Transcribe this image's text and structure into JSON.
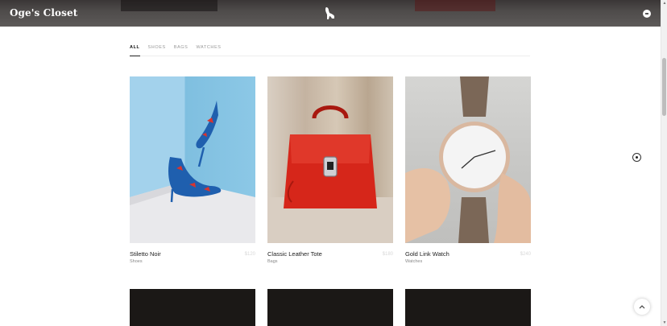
{
  "header": {
    "brand": "Oge's Closet",
    "logo_icon": "high-heel-logo-icon",
    "menu_icon": "menu-icon"
  },
  "filters": {
    "tabs": [
      {
        "label": "ALL",
        "active": true
      },
      {
        "label": "SHOES",
        "active": false
      },
      {
        "label": "BAGS",
        "active": false
      },
      {
        "label": "WATCHES",
        "active": false
      }
    ]
  },
  "products": [
    {
      "name": "Stiletto Noir",
      "category": "Shoes",
      "price": "$120",
      "image_icon": "floral-stiletto-image"
    },
    {
      "name": "Classic Leather Tote",
      "category": "Bags",
      "price": "$180",
      "image_icon": "red-handbag-image"
    },
    {
      "name": "Gold Link Watch",
      "category": "Watches",
      "price": "$240",
      "image_icon": "wristwatch-image"
    }
  ],
  "controls": {
    "side_dot_icon": "carousel-dot-icon",
    "back_to_top_icon": "chevron-up-icon"
  },
  "colors": {
    "header_bg": "#4e4b4a",
    "row2_card": "#1b1816"
  }
}
